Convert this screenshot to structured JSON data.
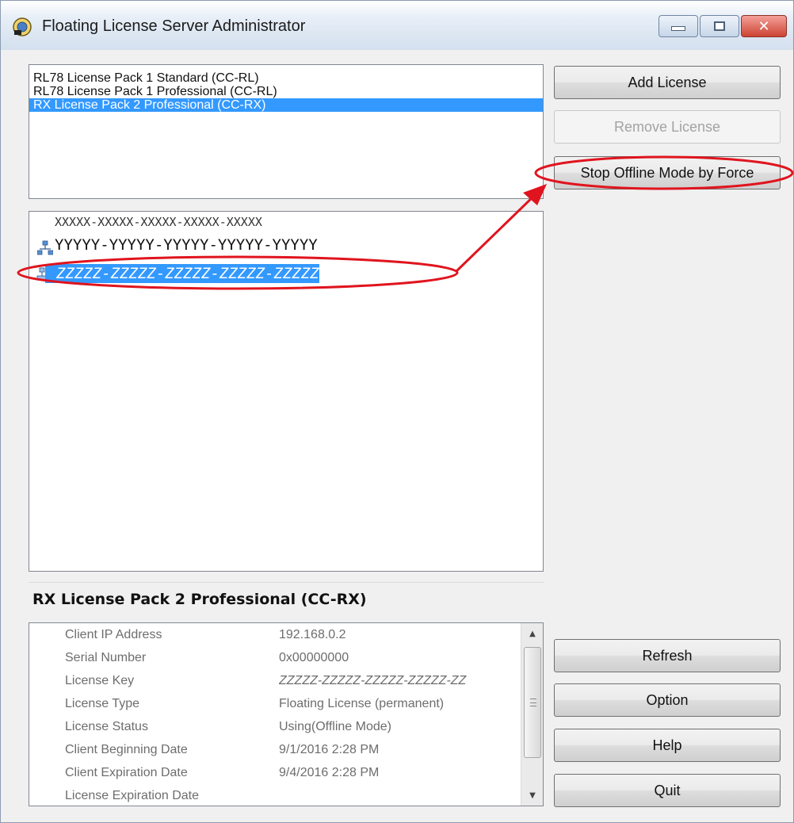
{
  "window": {
    "title": "Floating License Server Administrator"
  },
  "product_list": {
    "items": [
      "RL78 License Pack 1 Standard (CC-RL)",
      "RL78 License Pack 1 Professional (CC-RL)",
      "RX License Pack 2 Professional (CC-RX)"
    ],
    "selected_index": 2
  },
  "key_tree": {
    "items": [
      "XXXXX-XXXXX-XXXXX-XXXXX-XXXXX",
      "YYYYY-YYYYY-YYYYY-YYYYY-YYYYY",
      "ZZZZZ-ZZZZZ-ZZZZZ-ZZZZZ-ZZZZZ"
    ],
    "selected_index": 2
  },
  "detail": {
    "title": "RX License Pack 2 Professional (CC-RX)",
    "properties": [
      {
        "name": "Client IP Address",
        "value": "192.168.0.2"
      },
      {
        "name": "Serial Number",
        "value": "0x00000000"
      },
      {
        "name": "License Key",
        "value": "ZZZZZ-ZZZZZ-ZZZZZ-ZZZZZ-ZZ"
      },
      {
        "name": "License Type",
        "value": "Floating License (permanent)"
      },
      {
        "name": "License Status",
        "value": "Using(Offline Mode)"
      },
      {
        "name": "Client Beginning Date",
        "value": "9/1/2016 2:28 PM"
      },
      {
        "name": "Client Expiration Date",
        "value": "9/4/2016 2:28 PM"
      },
      {
        "name": "License Expiration Date",
        "value": ""
      }
    ]
  },
  "buttons": {
    "add_license": "Add License",
    "remove_license": "Remove License",
    "stop_offline": "Stop Offline Mode by Force",
    "refresh": "Refresh",
    "option": "Option",
    "help": "Help",
    "quit": "Quit"
  },
  "colors": {
    "selection": "#3399ff",
    "annotation": "#e0141e"
  }
}
